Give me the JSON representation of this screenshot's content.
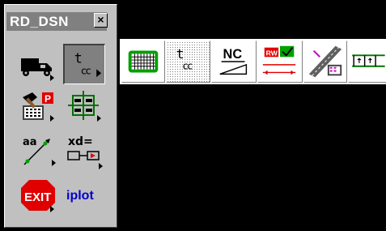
{
  "palette": {
    "title": "RD_DSN",
    "close_glyph": "×",
    "tools": [
      {
        "name": "truck-icon",
        "pressed": false
      },
      {
        "name": "tcc-icon",
        "label_main": "t",
        "label_sub": "cc",
        "pressed": true
      },
      {
        "name": "hammer-calculator-icon",
        "pressed": false
      },
      {
        "name": "grid-frame-icon",
        "pressed": false
      },
      {
        "name": "aa-line-icon",
        "label": "aa",
        "pressed": false
      },
      {
        "name": "xd-equals-icon",
        "label": "xd=",
        "pressed": false
      },
      {
        "name": "exit-sign-icon",
        "label": "EXIT",
        "pressed": false
      },
      {
        "name": "iplot-icon",
        "label": "iplot",
        "pressed": false
      }
    ]
  },
  "toolbar": {
    "tools": [
      {
        "name": "green-grid-icon"
      },
      {
        "name": "tcc-dotted-icon",
        "label_main": "t",
        "label_sub": "cc"
      },
      {
        "name": "nc-slope-icon",
        "label": "NC"
      },
      {
        "name": "rw-check-icon",
        "label": "RW"
      },
      {
        "name": "road-diagonal-icon"
      },
      {
        "name": "bridge-section-icon"
      }
    ]
  },
  "colors": {
    "background": "#000000",
    "panel": "#c0c0c0",
    "title_bar": "#808080",
    "accent_green": "#00a000",
    "accent_red": "#d01010",
    "accent_blue": "#0000d0"
  }
}
